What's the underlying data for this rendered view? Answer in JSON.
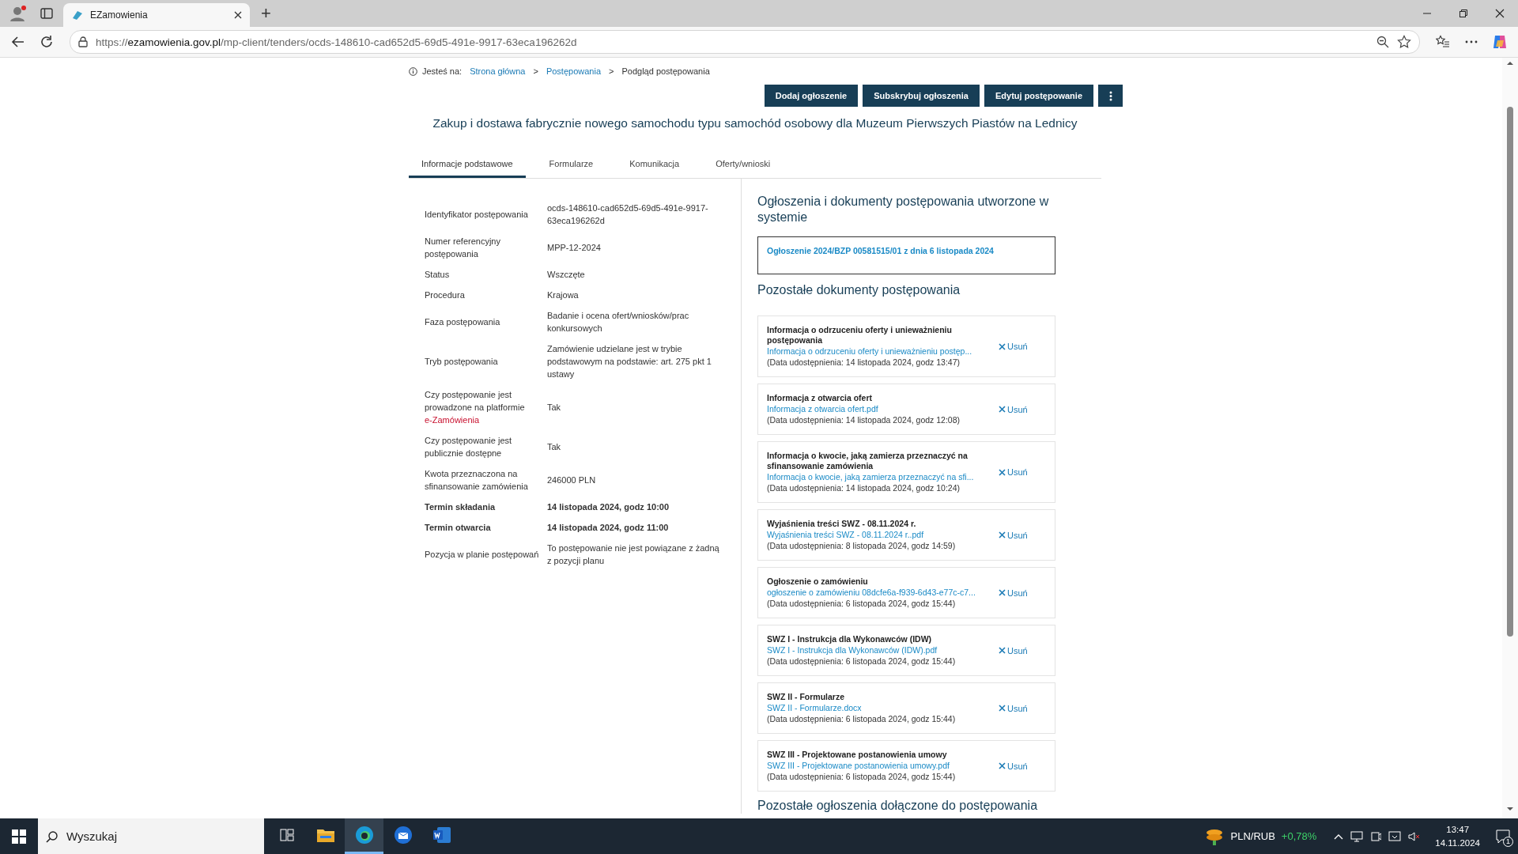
{
  "browser": {
    "tab_title": "EZamowienia",
    "new_tab": "+",
    "url_scheme": "https://",
    "url_host": "ezamowienia.gov.pl",
    "url_path": "/mp-client/tenders/ocds-148610-cad652d5-69d5-491e-9917-63eca196262d"
  },
  "breadcrumb": {
    "prefix": "Jesteś na:",
    "items": [
      {
        "label": "Strona główna",
        "kind": "link"
      },
      {
        "label": "Postępowania",
        "kind": "link"
      },
      {
        "label": "Podgląd postępowania",
        "kind": "current"
      }
    ],
    "separator": ">"
  },
  "actions": [
    "Dodaj ogłoszenie",
    "Subskrybuj ogłoszenia",
    "Edytuj postępowanie"
  ],
  "title": "Zakup i dostawa fabrycznie nowego samochodu typu samochód osobowy dla Muzeum Pierwszych Piastów na Lednicy",
  "tabs": [
    {
      "label": "Informacje podstawowe",
      "selected": true
    },
    {
      "label": "Formularze",
      "selected": false
    },
    {
      "label": "Komunikacja",
      "selected": false
    },
    {
      "label": "Oferty/wnioski",
      "selected": false
    }
  ],
  "details": [
    {
      "label": "Identyfikator postępowania",
      "value": "ocds-148610-cad652d5-69d5-491e-9917-63eca196262d",
      "bold": false
    },
    {
      "label": "Numer referencyjny postępowania",
      "value": "MPP-12-2024",
      "bold": false
    },
    {
      "label": "Status",
      "value": "Wszczęte",
      "bold": false
    },
    {
      "label": "Procedura",
      "value": "Krajowa",
      "bold": false
    },
    {
      "label": "Faza postępowania",
      "value": "Badanie i ocena ofert/wniosków/prac konkursowych",
      "bold": false
    },
    {
      "label": "Tryb postępowania",
      "value": "Zamówienie udzielane jest w trybie podstawowym na podstawie: art. 275 pkt 1 ustawy",
      "bold": false
    },
    {
      "label": "Czy postępowanie jest prowadzone na platformie",
      "label_link": "e-Zamówienia",
      "value": "Tak",
      "bold": false
    },
    {
      "label": "Czy postępowanie jest publicznie dostępne",
      "value": "Tak",
      "bold": false
    },
    {
      "label": "Kwota przeznaczona na sfinansowanie zamówienia",
      "value": "246000 PLN",
      "bold": false
    },
    {
      "label": "Termin składania",
      "value": "14 listopada 2024, godz 10:00",
      "bold": true
    },
    {
      "label": "Termin otwarcia",
      "value": "14 listopada 2024, godz 11:00",
      "bold": true
    },
    {
      "label": "Pozycja w planie postępowań",
      "value": "To postępowanie nie jest powiązane z żadną z pozycji planu",
      "bold": false
    }
  ],
  "system_docs": {
    "heading": "Ogłoszenia i dokumenty postępowania utworzone w systemie",
    "items": [
      "Ogłoszenie 2024/BZP 00581515/01 z dnia 6 listopada 2024"
    ]
  },
  "other_docs": {
    "heading": "Pozostałe dokumenty postępowania",
    "items": [
      {
        "title": "Informacja o odrzuceniu oferty i unieważnieniu postępowania",
        "file": "Informacja o odrzuceniu oferty i unieważnieniu postęp...",
        "date": "(Data udostępnienia: 14 listopada 2024, godz 13:47)",
        "action": "Usuń"
      },
      {
        "title": "Informacja z otwarcia ofert",
        "file": "Informacja z otwarcia ofert.pdf",
        "date": "(Data udostępnienia: 14 listopada 2024, godz 12:08)",
        "action": "Usuń"
      },
      {
        "title": "Informacja o kwocie, jaką zamierza przeznaczyć na sfinansowanie zamówienia",
        "file": "Informacja o kwocie, jaką zamierza przeznaczyć na sfi...",
        "date": "(Data udostępnienia: 14 listopada 2024, godz 10:24)",
        "action": "Usuń"
      },
      {
        "title": "Wyjaśnienia treści SWZ - 08.11.2024 r.",
        "file": "Wyjaśnienia treści SWZ - 08.11.2024 r..pdf",
        "date": "(Data udostępnienia: 8 listopada 2024, godz 14:59)",
        "action": "Usuń"
      },
      {
        "title": "Ogłoszenie o zamówieniu",
        "file": "ogłoszenie o zamówieniu 08dcfe6a-f939-6d43-e77c-c7...",
        "date": "(Data udostępnienia: 6 listopada 2024, godz 15:44)",
        "action": "Usuń"
      },
      {
        "title": "SWZ I - Instrukcja dla Wykonawców (IDW)",
        "file": "SWZ I - Instrukcja dla Wykonawców (IDW).pdf",
        "date": "(Data udostępnienia: 6 listopada 2024, godz 15:44)",
        "action": "Usuń"
      },
      {
        "title": "SWZ II - Formularze",
        "file": "SWZ II - Formularze.docx",
        "date": "(Data udostępnienia: 6 listopada 2024, godz 15:44)",
        "action": "Usuń"
      },
      {
        "title": "SWZ III - Projektowane postanowienia umowy",
        "file": "SWZ III - Projektowane postanowienia umowy.pdf",
        "date": "(Data udostępnienia: 6 listopada 2024, godz 15:44)",
        "action": "Usuń"
      }
    ]
  },
  "next_heading": "Pozostałe ogłoszenia dołączone do postępowania",
  "taskbar": {
    "search": "Wyszukaj",
    "apps": [
      {
        "kind": "taskview",
        "selected": false
      },
      {
        "kind": "explorer",
        "selected": false
      },
      {
        "kind": "edge",
        "selected": true
      },
      {
        "kind": "mail",
        "selected": false
      },
      {
        "kind": "word",
        "selected": false
      }
    ],
    "ticker": "PLN/RUB",
    "change": "+0,78%",
    "time": "13:47",
    "date": "14.11.2024",
    "notifications": "1"
  }
}
